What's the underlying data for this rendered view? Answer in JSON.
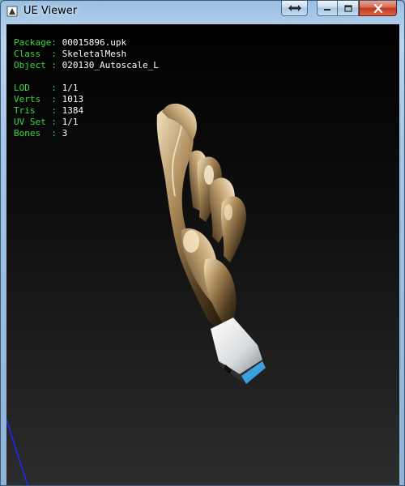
{
  "window": {
    "title": "UE Viewer",
    "controls": {
      "extra": "arrows-horizontal-icon",
      "minimize": "minimize-icon",
      "maximize": "maximize-icon",
      "close": "close-icon"
    }
  },
  "info": {
    "package_key": "Package: ",
    "package_val": "00015896.upk",
    "class_key": "Class  : ",
    "class_val": "SkeletalMesh",
    "object_key": "Object : ",
    "object_val": "020130_Autoscale_L",
    "lod_key": "LOD    : ",
    "lod_val": "1/1",
    "verts_key": "Verts  : ",
    "verts_val": "1013",
    "tris_key": "Tris   : ",
    "tris_val": "1384",
    "uvset_key": "UV Set : ",
    "uvset_val": "1/1",
    "bones_key": "Bones  : ",
    "bones_val": "3"
  },
  "colors": {
    "label_green": "#3fd73f",
    "value_white": "#ffffff",
    "mesh_gold": "#b89a6a",
    "axis_blue": "#1a2cff"
  }
}
